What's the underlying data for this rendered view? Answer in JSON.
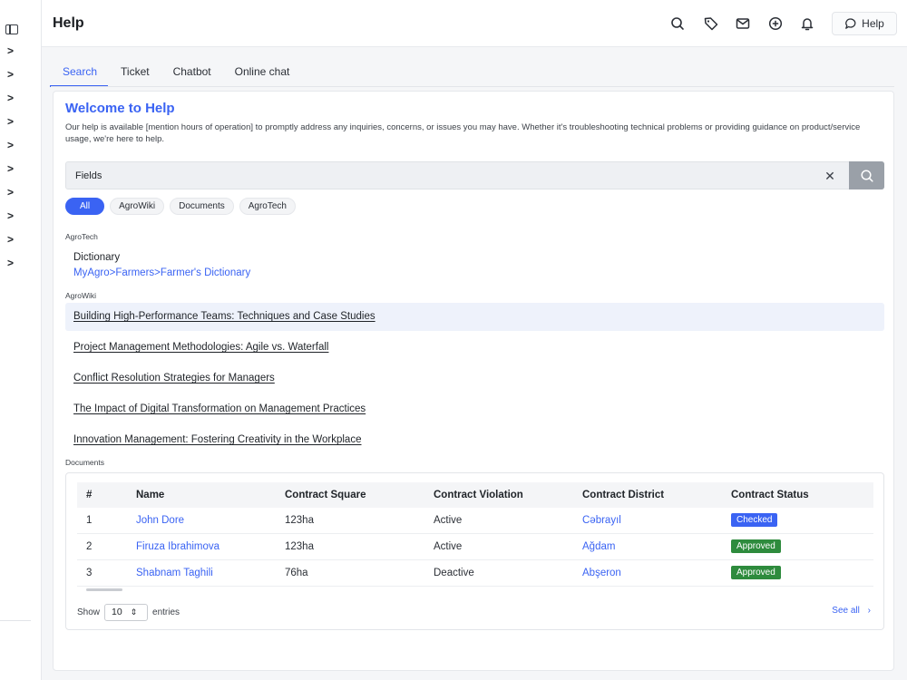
{
  "header": {
    "title": "Help",
    "help_button_label": "Help"
  },
  "tabs": [
    {
      "label": "Search",
      "active": true
    },
    {
      "label": "Ticket",
      "active": false
    },
    {
      "label": "Chatbot",
      "active": false
    },
    {
      "label": "Online chat",
      "active": false
    }
  ],
  "welcome": {
    "title": "Welcome to Help",
    "description": "Our help  is available [mention hours of operation] to promptly address any inquiries, concerns, or issues you may have. Whether it's troubleshooting technical problems or providing guidance on product/service usage, we're here to help."
  },
  "search": {
    "value": "Fields",
    "display_before_caret": "Fiel",
    "display_after_caret": "ds"
  },
  "filters": [
    {
      "label": "All",
      "active": true
    },
    {
      "label": "AgroWiki",
      "active": false
    },
    {
      "label": "Documents",
      "active": false
    },
    {
      "label": "AgroTech",
      "active": false
    }
  ],
  "agrotech": {
    "section_label": "AgroTech",
    "item_title": "Dictionary",
    "breadcrumb": [
      "MyAgro",
      "Farmers",
      "Farmer's Dictionary"
    ],
    "separator": ">"
  },
  "agrowiki": {
    "section_label": "AgroWiki",
    "items": [
      "Building High-Performance Teams: Techniques and Case Studies",
      "Project Management Methodologies: Agile vs. Waterfall",
      "Conflict Resolution Strategies for Managers",
      "The Impact of Digital Transformation on Management Practices",
      "Innovation Management: Fostering Creativity in the Workplace"
    ]
  },
  "documents": {
    "section_label": "Documents",
    "columns": [
      "#",
      "Name",
      "Contract Square",
      "Contract Violation",
      "Contract District",
      "Contract Status"
    ],
    "rows": [
      {
        "num": "1",
        "name": "John Dore",
        "square": "123ha",
        "violation": "Active",
        "district": "Cəbrayıl",
        "status": "Checked"
      },
      {
        "num": "2",
        "name": "Firuza Ibrahimova",
        "square": "123ha",
        "violation": "Active",
        "district": "Ağdam",
        "status": "Approved"
      },
      {
        "num": "3",
        "name": "Shabnam Taghili",
        "square": "76ha",
        "violation": "Deactive",
        "district": "Abşeron",
        "status": "Approved"
      }
    ],
    "show_label": "Show",
    "entries_value": "10",
    "entries_label": "entries",
    "see_all_label": "See all"
  },
  "colors": {
    "accent": "#3a63f3",
    "approved": "#2e8b3d",
    "checked": "#3a63f3"
  },
  "icons": [
    "sidebar-toggle-icon",
    "chevron-right-icon",
    "search-icon",
    "tag-icon",
    "mail-icon",
    "plus-circle-icon",
    "bell-icon",
    "chat-icon",
    "close-icon",
    "select-arrows-icon"
  ]
}
